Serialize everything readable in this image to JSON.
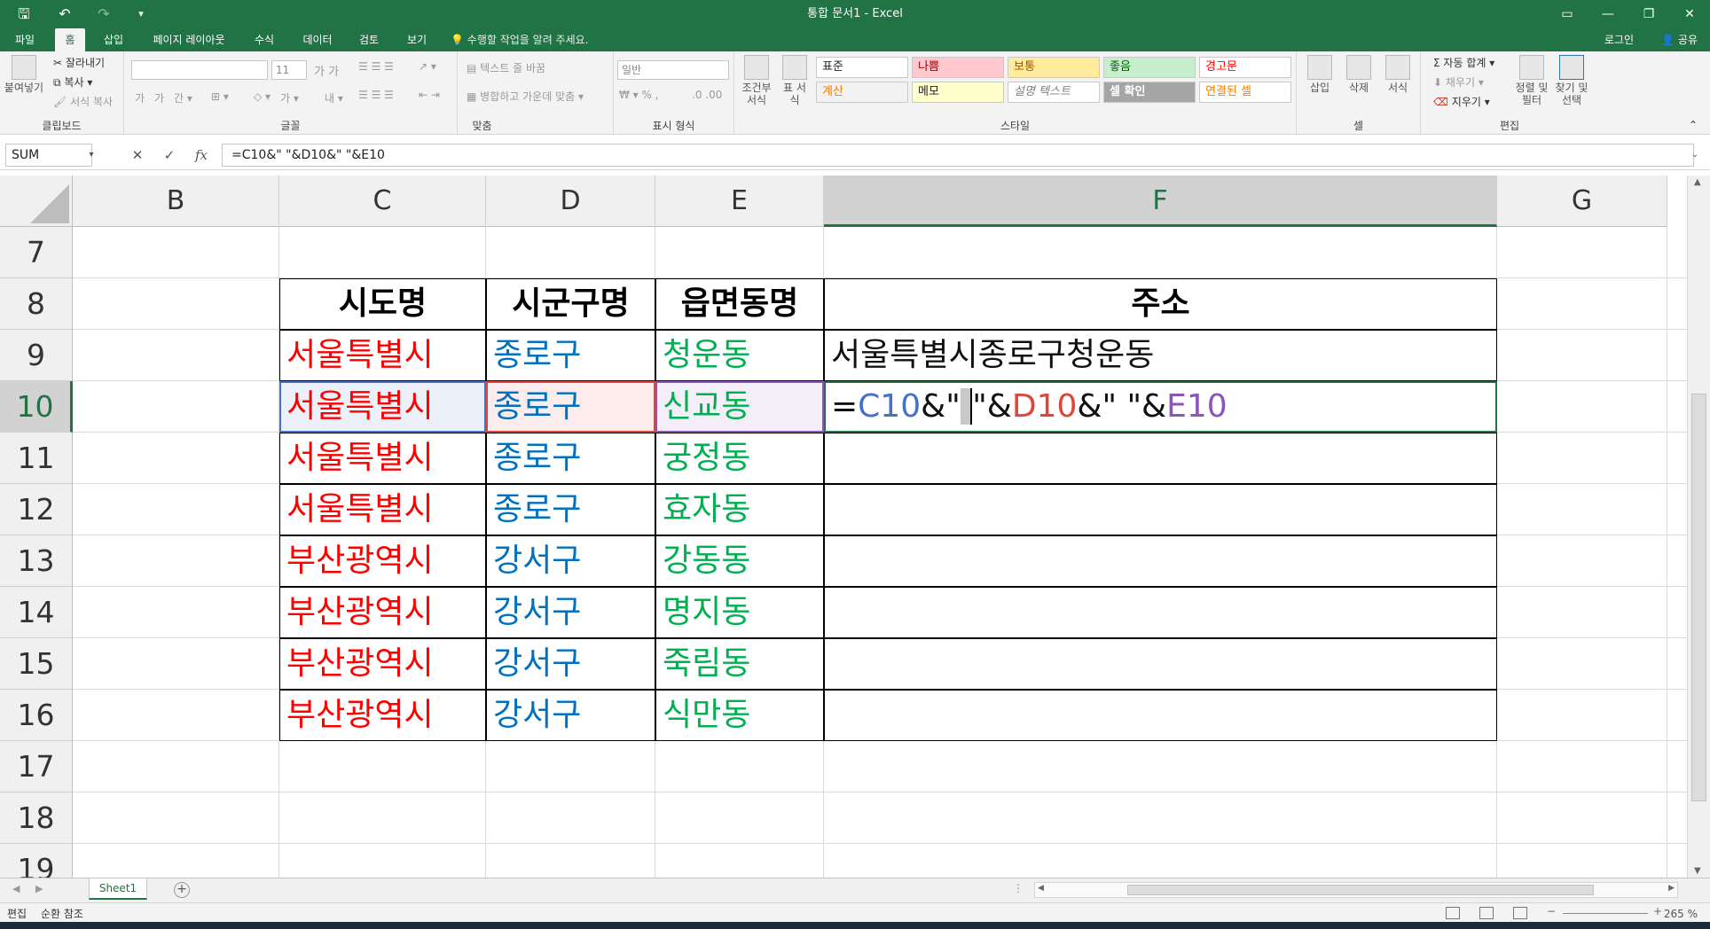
{
  "window": {
    "title": "통합 문서1 - Excel",
    "quick_access": {
      "save_icon": "save-icon",
      "undo_icon": "undo-icon",
      "redo_icon": "redo-icon",
      "customize_icon": "customize-icon"
    },
    "controls": {
      "ribbon_display": "▭",
      "minimize": "—",
      "restore": "❐",
      "close": "✕"
    }
  },
  "tabs": [
    {
      "label": "파일",
      "active": false
    },
    {
      "label": "홈",
      "active": true
    },
    {
      "label": "삽입",
      "active": false
    },
    {
      "label": "페이지 레이아웃",
      "active": false
    },
    {
      "label": "수식",
      "active": false
    },
    {
      "label": "데이터",
      "active": false
    },
    {
      "label": "검토",
      "active": false
    },
    {
      "label": "보기",
      "active": false
    }
  ],
  "tell_me": "수행할 작업을 알려 주세요.",
  "login": "로그인",
  "share": "공유",
  "ribbon": {
    "clipboard": {
      "label": "클립보드",
      "paste": "붙여넣기",
      "cut": "잘라내기",
      "copy": "복사",
      "format_painter": "서식 복사"
    },
    "font": {
      "label": "글꼴",
      "font_name": "",
      "font_size": "11"
    },
    "alignment": {
      "label": "맞춤",
      "wrap_text": "텍스트 줄 바꿈",
      "merge_center": "병합하고 가운데 맞춤"
    },
    "number": {
      "label": "표시 형식",
      "format": "일반"
    },
    "styles": {
      "label": "스타일",
      "conditional": "조건부 서식",
      "table": "표 서식",
      "cells": [
        {
          "text": "표준",
          "bg": "#ffffff",
          "color": "#000000"
        },
        {
          "text": "나쁨",
          "bg": "#ffc7ce",
          "color": "#9c0006"
        },
        {
          "text": "보통",
          "bg": "#ffeb9c",
          "color": "#9c5700"
        },
        {
          "text": "좋음",
          "bg": "#c6efce",
          "color": "#006100"
        },
        {
          "text": "경고문",
          "bg": "#ffffff",
          "color": "#ff0000"
        },
        {
          "text": "계산",
          "bg": "#f2f2f2",
          "color": "#fa7d00"
        },
        {
          "text": "메모",
          "bg": "#ffffcc",
          "color": "#000000"
        },
        {
          "text": "설명 텍스트",
          "bg": "#ffffff",
          "color": "#7f7f7f"
        },
        {
          "text": "셀 확인",
          "bg": "#a5a5a5",
          "color": "#ffffff"
        },
        {
          "text": "연결된 셀",
          "bg": "#ffffff",
          "color": "#fa7d00"
        }
      ]
    },
    "cells": {
      "label": "셀",
      "insert": "삽입",
      "delete": "삭제",
      "format": "서식"
    },
    "editing": {
      "label": "편집",
      "autosum": "자동 합계",
      "fill": "채우기",
      "clear": "지우기",
      "sort_filter": "정렬 및 필터",
      "find_select": "찾기 및 선택"
    }
  },
  "formula_bar": {
    "name_box": "SUM",
    "cancel": "✕",
    "enter": "✓",
    "fx": "fx",
    "formula": "=C10&\" \"&D10&\" \"&E10"
  },
  "columns": [
    {
      "label": "B",
      "selected": false
    },
    {
      "label": "C",
      "selected": false
    },
    {
      "label": "D",
      "selected": false
    },
    {
      "label": "E",
      "selected": false
    },
    {
      "label": "F",
      "selected": true
    },
    {
      "label": "G",
      "selected": false
    }
  ],
  "rows": [
    {
      "num": "7",
      "selected": false
    },
    {
      "num": "8",
      "selected": false
    },
    {
      "num": "9",
      "selected": false
    },
    {
      "num": "10",
      "selected": true
    },
    {
      "num": "11",
      "selected": false
    },
    {
      "num": "12",
      "selected": false
    },
    {
      "num": "13",
      "selected": false
    },
    {
      "num": "14",
      "selected": false
    },
    {
      "num": "15",
      "selected": false
    },
    {
      "num": "16",
      "selected": false
    },
    {
      "num": "17",
      "selected": false
    },
    {
      "num": "18",
      "selected": false
    },
    {
      "num": "19",
      "selected": false
    }
  ],
  "table": {
    "headers": [
      "시도명",
      "시군구명",
      "읍면동명",
      "주소"
    ],
    "rows": [
      {
        "c": "서울특별시",
        "d": "종로구",
        "e": "청운동",
        "f": "서울특별시종로구청운동"
      },
      {
        "c": "서울특별시",
        "d": "종로구",
        "e": "신교동",
        "f": ""
      },
      {
        "c": "서울특별시",
        "d": "종로구",
        "e": "궁정동",
        "f": ""
      },
      {
        "c": "서울특별시",
        "d": "종로구",
        "e": "효자동",
        "f": ""
      },
      {
        "c": "부산광역시",
        "d": "강서구",
        "e": "강동동",
        "f": ""
      },
      {
        "c": "부산광역시",
        "d": "강서구",
        "e": "명지동",
        "f": ""
      },
      {
        "c": "부산광역시",
        "d": "강서구",
        "e": "죽림동",
        "f": ""
      },
      {
        "c": "부산광역시",
        "d": "강서구",
        "e": "식만동",
        "f": ""
      }
    ]
  },
  "editing_cell": {
    "segments": [
      {
        "text": "=",
        "cls": ""
      },
      {
        "text": "C10",
        "cls": "fseg-c"
      },
      {
        "text": "&\"",
        "cls": ""
      },
      {
        "text": " ",
        "cls": "fsel"
      },
      {
        "text": "\"&",
        "cls": ""
      },
      {
        "text": "D10",
        "cls": "fseg-d"
      },
      {
        "text": "&\" \"&",
        "cls": ""
      },
      {
        "text": "E10",
        "cls": "fseg-e"
      }
    ]
  },
  "sheets": [
    {
      "name": "Sheet1",
      "active": true
    }
  ],
  "status": {
    "mode": "편집",
    "circular": "순환 참조",
    "zoom": "265 %"
  },
  "colors": {
    "accent": "#217346",
    "city": "#ff0000",
    "district": "#0070c0",
    "dong": "#00b050"
  }
}
